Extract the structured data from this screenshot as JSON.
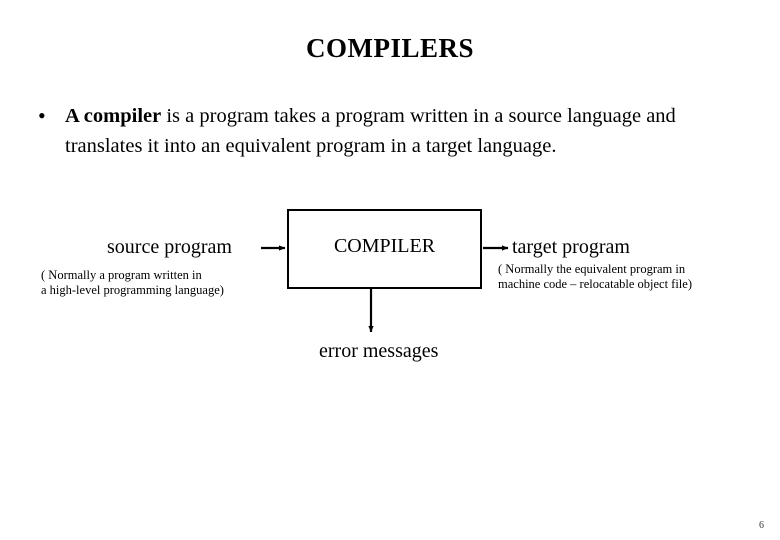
{
  "slide": {
    "title": "COMPILERS",
    "page_number": "6",
    "background_color": "#ffffff",
    "text_color": "#000000"
  },
  "bullet": {
    "marker": "•",
    "lead_bold": "A compiler",
    "rest": " is a program takes a program written in a source language and translates it into an equivalent program in a target language."
  },
  "diagram": {
    "box_label": "COMPILER",
    "input_label": "source program",
    "input_note_line1": "( Normally a program written in",
    "input_note_line2": "a high-level programming language)",
    "output_label": "target program",
    "output_note_line1": "( Normally the equivalent program in",
    "output_note_line2": "machine code – relocatable object file)",
    "error_label": "error messages",
    "stroke_color": "#000000"
  }
}
